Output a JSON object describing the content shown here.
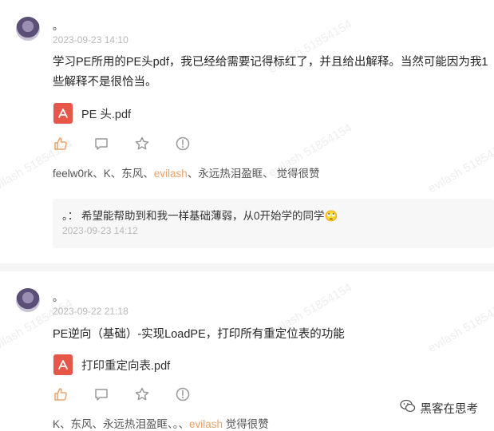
{
  "posts": [
    {
      "author": "。",
      "time": "2023-09-23 14:10",
      "content_line1": "学习PE所用的PE头pdf，我已经给需要记得标红了，并且给出解释。当然可能因为我1",
      "content_line2": "些解释不是很恰当。",
      "file_name": "PE 头.pdf",
      "likes_pre": "feelw0rk、K、东风、",
      "likes_hl": "evilash",
      "likes_post": "、永远热泪盈眶、 觉得很赞",
      "reply": {
        "text": "。：  希望能帮助到和我一样基础薄弱，从0开始学的同学🙄",
        "time": "2023-09-23 14:12"
      }
    },
    {
      "author": "。",
      "time": "2023-09-22 21:18",
      "content_line1": "PE逆向（基础）-实现LoadPE，打印所有重定位表的功能",
      "file_name": "打印重定向表.pdf",
      "likes_pre": "K、东风、永远热泪盈眶、。、",
      "likes_hl": "evilash",
      "likes_post": " 觉得很赞"
    }
  ],
  "watermark_text": "evilash 51854154",
  "brand": "黑客在思考",
  "icons": [
    "avatar",
    "pdf-icon",
    "like-icon",
    "comment-icon",
    "star-icon",
    "report-icon",
    "wechat-icon"
  ],
  "colors": {
    "pdf": "#e6574a",
    "highlight": "#e9a36b",
    "reply_bg": "#f7f7f7"
  }
}
